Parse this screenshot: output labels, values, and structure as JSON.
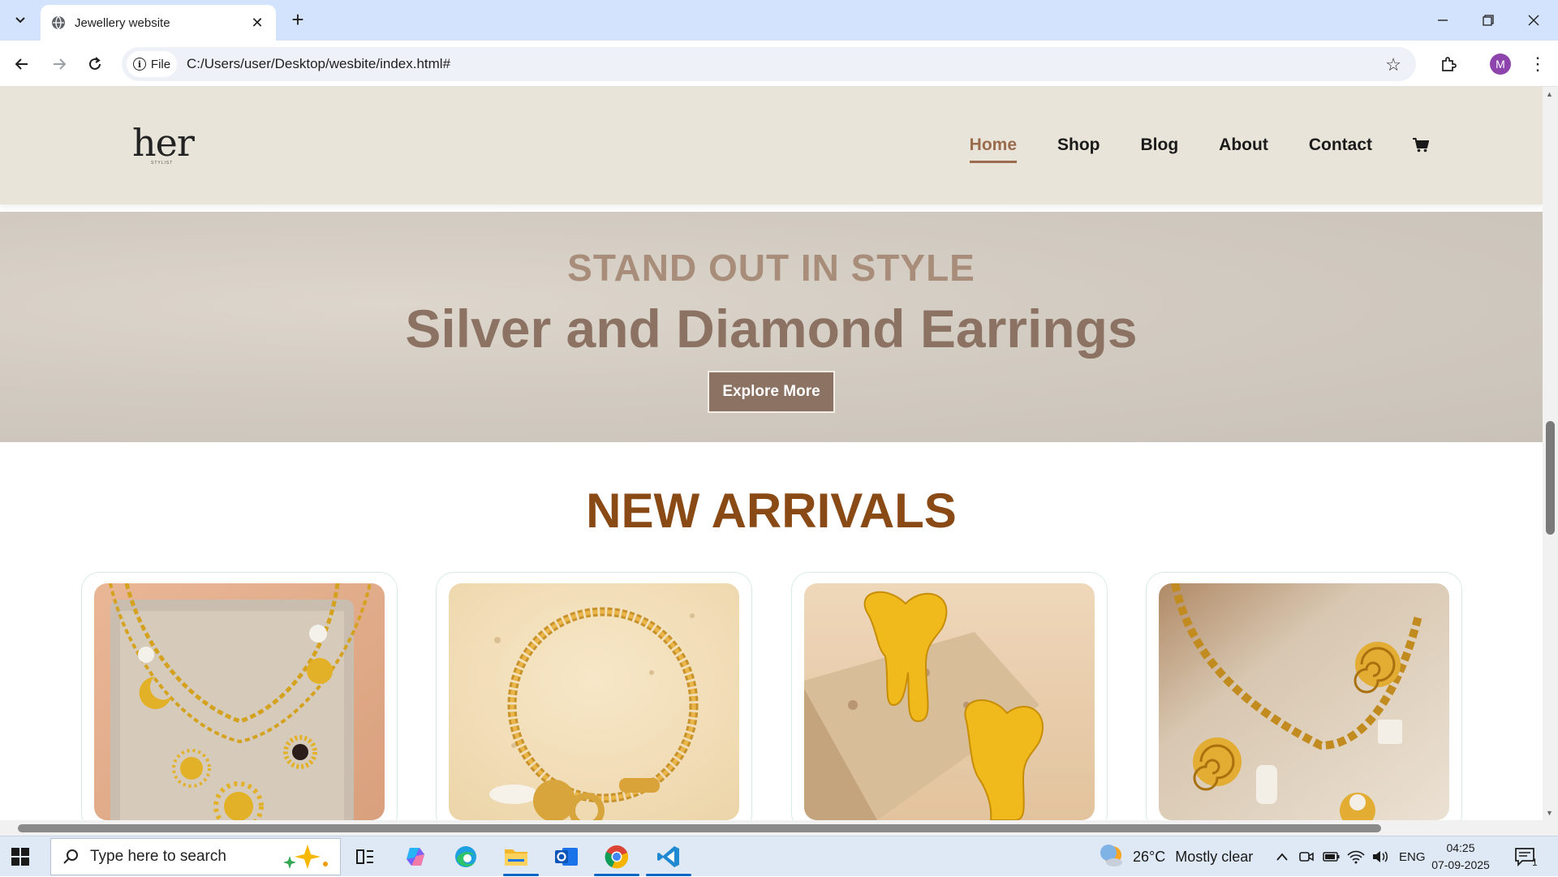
{
  "browser": {
    "tab_title": "Jewellery website",
    "url_scheme_chip": "File",
    "url": "C:/Users/user/Desktop/wesbite/index.html#",
    "profile_initial": "M"
  },
  "site": {
    "logo": "her",
    "logo_sub": "STYLIST",
    "nav": [
      "Home",
      "Shop",
      "Blog",
      "About",
      "Contact"
    ],
    "active_nav": "Home"
  },
  "hero": {
    "kicker": "STAND OUT IN STYLE",
    "title": "Silver and Diamond Earrings",
    "button": "Explore More"
  },
  "arrivals": {
    "title": "NEW ARRIVALS",
    "products": [
      {
        "kind": "charm-necklace"
      },
      {
        "kind": "gold-bracelet"
      },
      {
        "kind": "melting-heart-earrings"
      },
      {
        "kind": "swirl-charm-necklace"
      }
    ]
  },
  "taskbar": {
    "search_placeholder": "Type here to search",
    "temperature": "26°C",
    "weather": "Mostly clear",
    "language": "ENG",
    "time": "04:25",
    "date": "07-09-2025",
    "notifications": "1"
  },
  "colors": {
    "accent": "#9b6b4d",
    "hero_text": "#8c7262",
    "arrivals_title": "#8a4a16",
    "header_bg": "#e9e4d9"
  }
}
